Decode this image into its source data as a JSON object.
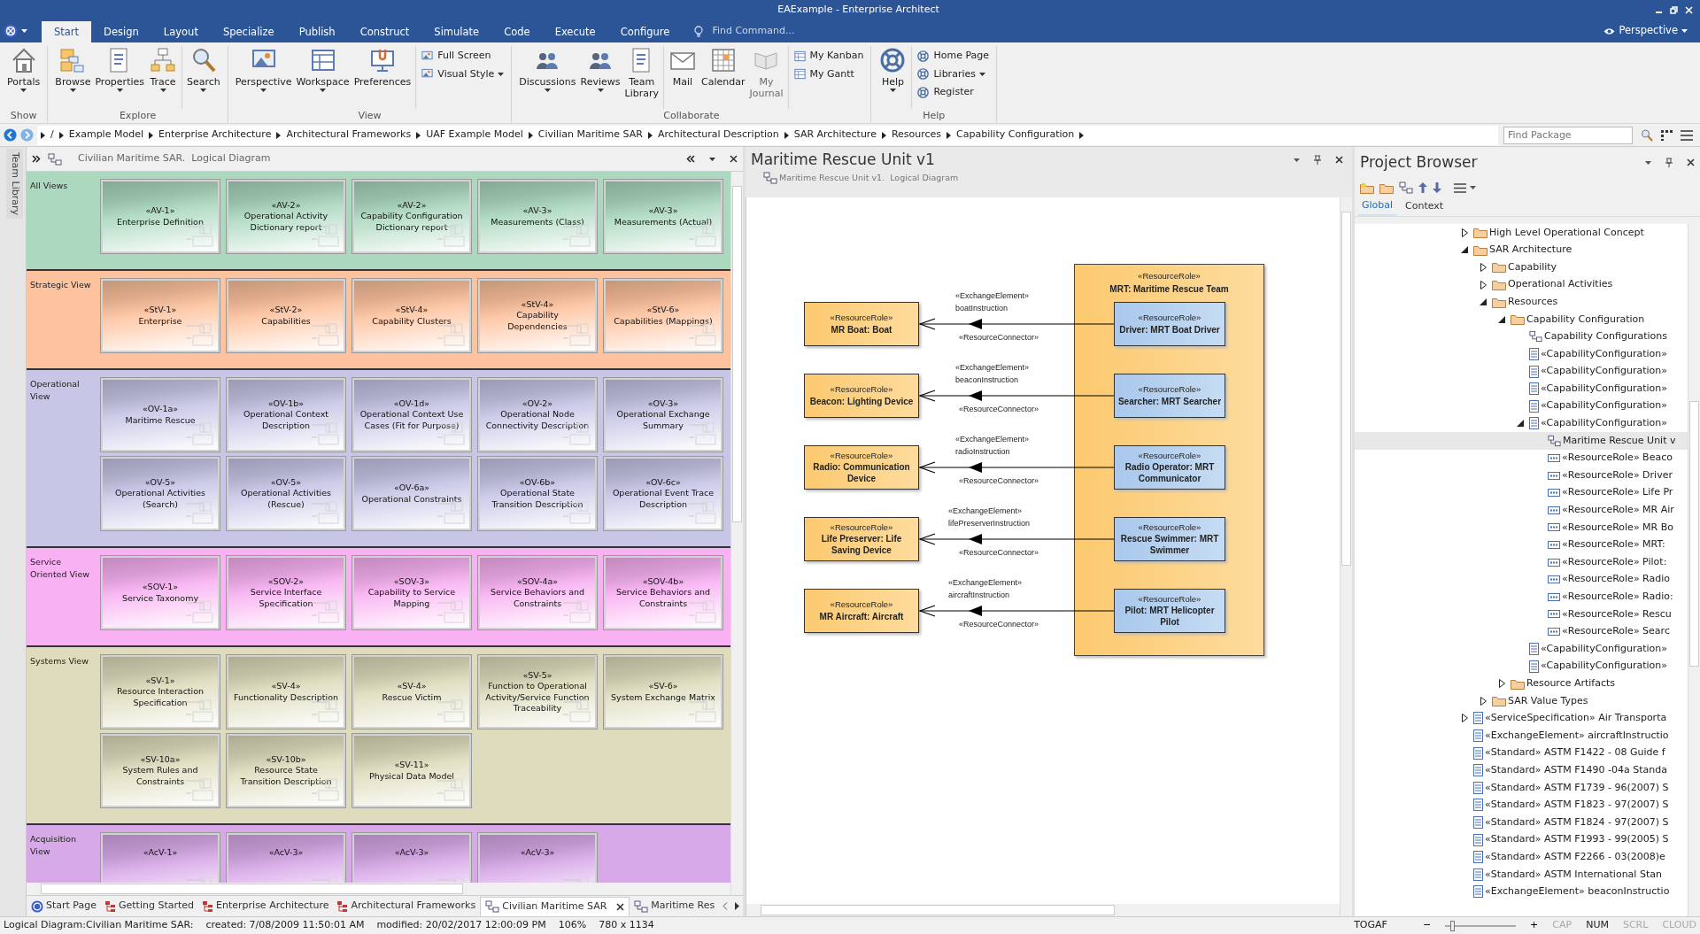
{
  "window": {
    "title": "EAExample - Enterprise Architect"
  },
  "menu_tabs": [
    {
      "label": "Start",
      "selected": true
    },
    {
      "label": "Design",
      "selected": false
    },
    {
      "label": "Layout",
      "selected": false
    },
    {
      "label": "Specialize",
      "selected": false
    },
    {
      "label": "Publish",
      "selected": false
    },
    {
      "label": "Construct",
      "selected": false
    },
    {
      "label": "Simulate",
      "selected": false
    },
    {
      "label": "Code",
      "selected": false
    },
    {
      "label": "Execute",
      "selected": false
    },
    {
      "label": "Configure",
      "selected": false
    }
  ],
  "find_command": {
    "placeholder": "Find Command..."
  },
  "perspective": "Perspective",
  "ribbon": {
    "groups": [
      {
        "label": "Show",
        "clusters": [
          [
            {
              "label": "Portals",
              "kind": "large",
              "dropdown": true,
              "disabled": false
            }
          ]
        ]
      },
      {
        "label": "Explore",
        "clusters": [
          [
            {
              "label": "Browse",
              "kind": "large",
              "dropdown": true,
              "disabled": false
            },
            {
              "label": "Properties",
              "kind": "large",
              "dropdown": true,
              "disabled": false
            },
            {
              "label": "Trace",
              "kind": "large",
              "dropdown": true,
              "disabled": false
            }
          ],
          [
            {
              "label": "Search",
              "kind": "large",
              "dropdown": true,
              "disabled": false
            }
          ]
        ]
      },
      {
        "label": "View",
        "clusters": [
          [
            {
              "label": "Perspective",
              "kind": "large",
              "dropdown": true,
              "disabled": false
            },
            {
              "label": "Workspace",
              "kind": "large",
              "dropdown": true,
              "disabled": false
            },
            {
              "label": "Preferences",
              "kind": "large",
              "dropdown": false,
              "disabled": false
            }
          ],
          [
            {
              "label": "Full Screen",
              "kind": "small",
              "dropdown": false,
              "disabled": false
            },
            {
              "label": "Visual Style",
              "kind": "small",
              "dropdown": true,
              "disabled": false
            }
          ]
        ]
      },
      {
        "label": "Collaborate",
        "clusters": [
          [
            {
              "label": "Discussions",
              "kind": "large",
              "dropdown": true,
              "disabled": false
            },
            {
              "label": "Reviews",
              "kind": "large",
              "dropdown": true,
              "disabled": false
            },
            {
              "label": "Team Library",
              "kind": "large",
              "dropdown": false,
              "disabled": false
            }
          ],
          [
            {
              "label": "Mail",
              "kind": "large",
              "dropdown": false,
              "disabled": false
            },
            {
              "label": "Calendar",
              "kind": "large",
              "dropdown": false,
              "disabled": false
            },
            {
              "label": "My Journal",
              "kind": "large",
              "dropdown": false,
              "disabled": true
            }
          ],
          [
            {
              "label": "My Kanban",
              "kind": "small",
              "dropdown": false,
              "disabled": false
            },
            {
              "label": "My Gantt",
              "kind": "small",
              "dropdown": false,
              "disabled": false
            }
          ]
        ]
      },
      {
        "label": "Help",
        "clusters": [
          [
            {
              "label": "Help",
              "kind": "large",
              "dropdown": true,
              "disabled": false
            }
          ],
          [
            {
              "label": "Home Page",
              "kind": "small",
              "dropdown": false,
              "disabled": false
            },
            {
              "label": "Libraries",
              "kind": "small",
              "dropdown": true,
              "disabled": false
            },
            {
              "label": "Register",
              "kind": "small",
              "dropdown": false,
              "disabled": false
            }
          ]
        ]
      }
    ]
  },
  "breadcrumb": [
    "/",
    "Example Model",
    "Enterprise Architecture",
    "Architectural Frameworks",
    "UAF Example Model",
    "Civilian Maritime SAR",
    "Architectural Description",
    "SAR Architecture",
    "Resources",
    "Capability Configuration"
  ],
  "find_package": {
    "placeholder": "Find Package"
  },
  "side_tab": "Team Library",
  "left_view": {
    "title": "Civilian Maritime SAR.  Logical Diagram",
    "lanes": [
      {
        "label": "All Views",
        "color": "#abd8bf",
        "tiles": [
          {
            "stereotype": "«AV-1»",
            "name": "Enterprise Definition"
          },
          {
            "stereotype": "«AV-2»",
            "name": "Operational Activity Dictionary report"
          },
          {
            "stereotype": "«AV-2»",
            "name": "Capability Configuration Dictionary report"
          },
          {
            "stereotype": "«AV-3»",
            "name": "Measurements (Class)"
          },
          {
            "stereotype": "«AV-3»",
            "name": "Measurements (Actual)"
          }
        ]
      },
      {
        "label": "Strategic View",
        "color": "#fdc29e",
        "tiles": [
          {
            "stereotype": "«StV-1»",
            "name": "Enterprise"
          },
          {
            "stereotype": "«StV-2»",
            "name": "Capabilities"
          },
          {
            "stereotype": "«StV-4»",
            "name": "Capability Clusters"
          },
          {
            "stereotype": "«StV-4»",
            "name": "Capability Dependencies"
          },
          {
            "stereotype": "«StV-6»",
            "name": "Capabilities (Mappings)"
          }
        ]
      },
      {
        "label": "Operational View",
        "color": "#c7c6e7",
        "tiles": [
          {
            "stereotype": "«OV-1a»",
            "name": "Maritime Rescue"
          },
          {
            "stereotype": "«OV-1b»",
            "name": "Operational Context Description"
          },
          {
            "stereotype": "«OV-1d»",
            "name": "Operational Context Use Cases (Fit for Purpose)"
          },
          {
            "stereotype": "«OV-2»",
            "name": "Operational Node Connectivity Description"
          },
          {
            "stereotype": "«OV-3»",
            "name": "Operational Exchange Summary"
          },
          {
            "stereotype": "«OV-5»",
            "name": "Operational Activities (Search)"
          },
          {
            "stereotype": "«OV-5»",
            "name": "Operational Activities (Rescue)"
          },
          {
            "stereotype": "«OV-6a»",
            "name": "Operational Constraints"
          },
          {
            "stereotype": "«OV-6b»",
            "name": "Operational State Transition Description"
          },
          {
            "stereotype": "«OV-6c»",
            "name": "Operational Event Trace Description"
          }
        ]
      },
      {
        "label": "Service Oriented View",
        "color": "#f8b1f2",
        "tiles": [
          {
            "stereotype": "«SOV-1»",
            "name": "Service Taxonomy"
          },
          {
            "stereotype": "«SOV-2»",
            "name": "Service Interface Specification"
          },
          {
            "stereotype": "«SOV-3»",
            "name": "Capability to Service Mapping"
          },
          {
            "stereotype": "«SOV-4a»",
            "name": "Service Behaviors and Constraints"
          },
          {
            "stereotype": "«SOV-4b»",
            "name": "Service Behaviors and Constraints"
          }
        ]
      },
      {
        "label": "Systems View",
        "color": "#dedcbc",
        "tiles": [
          {
            "stereotype": "«SV-1»",
            "name": "Resource Interaction Specification"
          },
          {
            "stereotype": "«SV-4»",
            "name": "Functionality Description"
          },
          {
            "stereotype": "«SV-4»",
            "name": "Rescue Victim"
          },
          {
            "stereotype": "«SV-5»",
            "name": "Function to Operational Activity/Service Function Traceability"
          },
          {
            "stereotype": "«SV-6»",
            "name": "System Exchange Matrix"
          },
          {
            "stereotype": "«SV-10a»",
            "name": "System Rules and Constraints"
          },
          {
            "stereotype": "«SV-10b»",
            "name": "Resource State Transition Description"
          },
          {
            "stereotype": "«SV-11»",
            "name": "Physical Data Model"
          }
        ]
      },
      {
        "label": "Acquisition View",
        "color": "#d8a9e8",
        "tiles": [
          {
            "stereotype": "«AcV-1»"
          },
          {
            "stereotype": "«AcV-3»"
          },
          {
            "stereotype": "«AcV-3»"
          },
          {
            "stereotype": "«AcV-3»"
          }
        ]
      }
    ]
  },
  "doc_tabs": [
    {
      "label": "Start Page",
      "kind": "start",
      "selected": false
    },
    {
      "label": "Getting Started",
      "kind": "tree",
      "selected": false
    },
    {
      "label": "Enterprise Architecture",
      "kind": "tree",
      "selected": false
    },
    {
      "label": "Architectural Frameworks",
      "kind": "tree",
      "selected": false
    },
    {
      "label": "Civilian Maritime SAR",
      "kind": "diagram",
      "selected": true
    },
    {
      "label": "Maritime Res",
      "kind": "diagram",
      "selected": false
    }
  ],
  "center_view": {
    "title": "Maritime Rescue Unit v1",
    "subtitle": "Maritime Rescue Unit v1.  Logical Diagram",
    "container": {
      "stereotype": "«ResourceRole»",
      "name": "MRT: Maritime Rescue Team"
    },
    "rows": [
      {
        "left": {
          "stereotype": "«ResourceRole»",
          "name": "MR Boat: Boat"
        },
        "right": {
          "stereotype": "«ResourceRole»",
          "name": "Driver: MRT Boat Driver"
        },
        "exchange_stereotype": "«ExchangeElement»",
        "exchange_name": "boatInstruction",
        "connector_stereotype": "«ResourceConnector»"
      },
      {
        "left": {
          "stereotype": "«ResourceRole»",
          "name": "Beacon: Lighting Device"
        },
        "right": {
          "stereotype": "«ResourceRole»",
          "name": "Searcher: MRT Searcher"
        },
        "exchange_stereotype": "«ExchangeElement»",
        "exchange_name": "beaconInstruction",
        "connector_stereotype": "«ResourceConnector»"
      },
      {
        "left": {
          "stereotype": "«ResourceRole»",
          "name": "Radio: Communication Device"
        },
        "right": {
          "stereotype": "«ResourceRole»",
          "name": "Radio Operator: MRT Communicator"
        },
        "exchange_stereotype": "«ExchangeElement»",
        "exchange_name": "radioInstruction",
        "connector_stereotype": "«ResourceConnector»"
      },
      {
        "left": {
          "stereotype": "«ResourceRole»",
          "name": "Life Preserver: Life Saving Device"
        },
        "right": {
          "stereotype": "«ResourceRole»",
          "name": "Rescue Swimmer: MRT Swimmer"
        },
        "exchange_stereotype": "«ExchangeElement»",
        "exchange_name": "lifePreserverInstruction",
        "connector_stereotype": "«ResourceConnector»"
      },
      {
        "left": {
          "stereotype": "«ResourceRole»",
          "name": "MR Aircraft: Aircraft"
        },
        "right": {
          "stereotype": "«ResourceRole»",
          "name": "Pilot: MRT Helicopter Pilot"
        },
        "exchange_stereotype": "«ExchangeElement»",
        "exchange_name": "aircraftInstruction",
        "connector_stereotype": "«ResourceConnector»"
      }
    ]
  },
  "project_browser": {
    "title": "Project Browser",
    "tabs": [
      {
        "label": "Global",
        "selected": true
      },
      {
        "label": "Context",
        "selected": false
      }
    ],
    "tree": [
      {
        "label": "High Level Operational Concept",
        "kind": "folder",
        "expanded": false,
        "selected": false
      },
      {
        "label": "SAR Architecture",
        "kind": "folder",
        "expanded": true,
        "selected": false,
        "children": [
          {
            "label": "Capability",
            "kind": "folder",
            "expanded": false,
            "selected": false
          },
          {
            "label": "Operational Activities",
            "kind": "folder",
            "expanded": false,
            "selected": false
          },
          {
            "label": "Resources",
            "kind": "folder",
            "expanded": true,
            "selected": false,
            "children": [
              {
                "label": "Capability Configuration",
                "kind": "folder",
                "expanded": true,
                "selected": false,
                "children": [
                  {
                    "label": "Capability Configurations",
                    "kind": "diagram",
                    "selected": false
                  },
                  {
                    "label": "«CapabilityConfiguration»",
                    "kind": "element",
                    "selected": false
                  },
                  {
                    "label": "«CapabilityConfiguration»",
                    "kind": "element",
                    "selected": false
                  },
                  {
                    "label": "«CapabilityConfiguration»",
                    "kind": "element",
                    "selected": false
                  },
                  {
                    "label": "«CapabilityConfiguration»",
                    "kind": "element",
                    "selected": false
                  },
                  {
                    "label": "«CapabilityConfiguration»",
                    "kind": "element",
                    "expanded": true,
                    "selected": false,
                    "children": [
                      {
                        "label": "Maritime Rescue Unit v",
                        "kind": "diagram",
                        "selected": true
                      },
                      {
                        "label": "«ResourceRole» Beaco",
                        "kind": "part",
                        "selected": false
                      },
                      {
                        "label": "«ResourceRole» Driver",
                        "kind": "part",
                        "selected": false
                      },
                      {
                        "label": "«ResourceRole» Life Pr",
                        "kind": "part",
                        "selected": false
                      },
                      {
                        "label": "«ResourceRole» MR Air",
                        "kind": "part",
                        "selected": false
                      },
                      {
                        "label": "«ResourceRole» MR Bo",
                        "kind": "part",
                        "selected": false
                      },
                      {
                        "label": "«ResourceRole» MRT:",
                        "kind": "part",
                        "selected": false
                      },
                      {
                        "label": "«ResourceRole» Pilot:",
                        "kind": "part",
                        "selected": false
                      },
                      {
                        "label": "«ResourceRole» Radio",
                        "kind": "part",
                        "selected": false
                      },
                      {
                        "label": "«ResourceRole» Radio:",
                        "kind": "part",
                        "selected": false
                      },
                      {
                        "label": "«ResourceRole» Rescu",
                        "kind": "part",
                        "selected": false
                      },
                      {
                        "label": "«ResourceRole» Searc",
                        "kind": "part",
                        "selected": false
                      }
                    ]
                  },
                  {
                    "label": "«CapabilityConfiguration»",
                    "kind": "element",
                    "selected": false
                  },
                  {
                    "label": "«CapabilityConfiguration»",
                    "kind": "element",
                    "selected": false
                  }
                ]
              },
              {
                "label": "Resource Artifacts",
                "kind": "folder",
                "expanded": false,
                "selected": false
              }
            ]
          },
          {
            "label": "SAR Value Types",
            "kind": "folder",
            "expanded": false,
            "selected": false
          }
        ]
      },
      {
        "label": "«ServiceSpecification» Air Transporta",
        "kind": "element",
        "expanded": false,
        "selected": false
      },
      {
        "label": "«ExchangeElement» aircraftInstructio",
        "kind": "element",
        "selected": false
      },
      {
        "label": "«Standard» ASTM F1422 - 08 Guide f",
        "kind": "element",
        "selected": false
      },
      {
        "label": "«Standard» ASTM F1490 -04a Standa",
        "kind": "element",
        "selected": false
      },
      {
        "label": "«Standard» ASTM F1739 - 96(2007) S",
        "kind": "element",
        "selected": false
      },
      {
        "label": "«Standard» ASTM F1823 - 97(2007) S",
        "kind": "element",
        "selected": false
      },
      {
        "label": "«Standard» ASTM F1824 - 97(2007) S",
        "kind": "element",
        "selected": false
      },
      {
        "label": "«Standard» ASTM F1993 - 99(2005) S",
        "kind": "element",
        "selected": false
      },
      {
        "label": "«Standard» ASTM F2266 - 03(2008)e",
        "kind": "element",
        "selected": false
      },
      {
        "label": "«Standard» ASTM International Stan",
        "kind": "element",
        "selected": false
      },
      {
        "label": "«ExchangeElement» beaconInstructio",
        "kind": "element",
        "selected": false
      }
    ]
  },
  "status_bar": {
    "fields": [
      "Logical Diagram:Civilian Maritime SAR:",
      "created: 7/08/2009 11:50:01 AM",
      "modified: 20/02/2017 12:00:09 PM",
      "106%",
      "780 x 1134"
    ],
    "framework": "TOGAF",
    "zoom_out": "−",
    "zoom_in": "+",
    "zoom": {
      "level": 0.08
    },
    "indicators": [
      {
        "label": "CAP",
        "on": false
      },
      {
        "label": "NUM",
        "on": true
      },
      {
        "label": "SCRL",
        "on": false
      },
      {
        "label": "CLOUD",
        "on": false
      }
    ]
  }
}
